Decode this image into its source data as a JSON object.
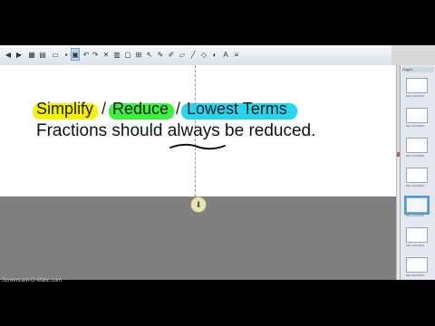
{
  "slide": {
    "title_words": [
      "Simplify",
      "/",
      "Reduce",
      "/",
      "Lowest Terms"
    ],
    "body_before": "Fractions should ",
    "body_emph": "always",
    "body_after": " be reduced."
  },
  "colors": {
    "highlight_yellow": "#f4f200",
    "highlight_green": "#3cf23c",
    "highlight_cyan": "#27d5ee",
    "accent_blue": "#4a9ed9"
  },
  "toolbar": {
    "icons": [
      "back-icon",
      "forward-icon",
      "new-page-icon",
      "delete-page-icon",
      "open-icon",
      "save-icon",
      "paste-icon",
      "undo-icon",
      "redo-icon",
      "delete-icon",
      "screen-shade-icon",
      "full-screen-icon",
      "table-icon",
      "select-icon",
      "pen-icon",
      "highlighter-icon",
      "eraser-icon",
      "line-icon",
      "shape-icon",
      "fill-icon",
      "text-icon",
      "properties-icon"
    ]
  },
  "sidebar": {
    "header": "Pages",
    "pages": [
      {
        "label": "Mon 21/1/2013"
      },
      {
        "label": "Mon 21/1/2013"
      },
      {
        "label": "Mon 21/1/2013"
      },
      {
        "label": "Mon 21/1/2013"
      },
      {
        "label": "Mon 21/1/2013"
      },
      {
        "label": "Mon 21/1/2013"
      },
      {
        "label": "Mon 21/1/2013"
      }
    ],
    "selected_index": 4
  },
  "watermark": "Screencast-O-Matic.com"
}
